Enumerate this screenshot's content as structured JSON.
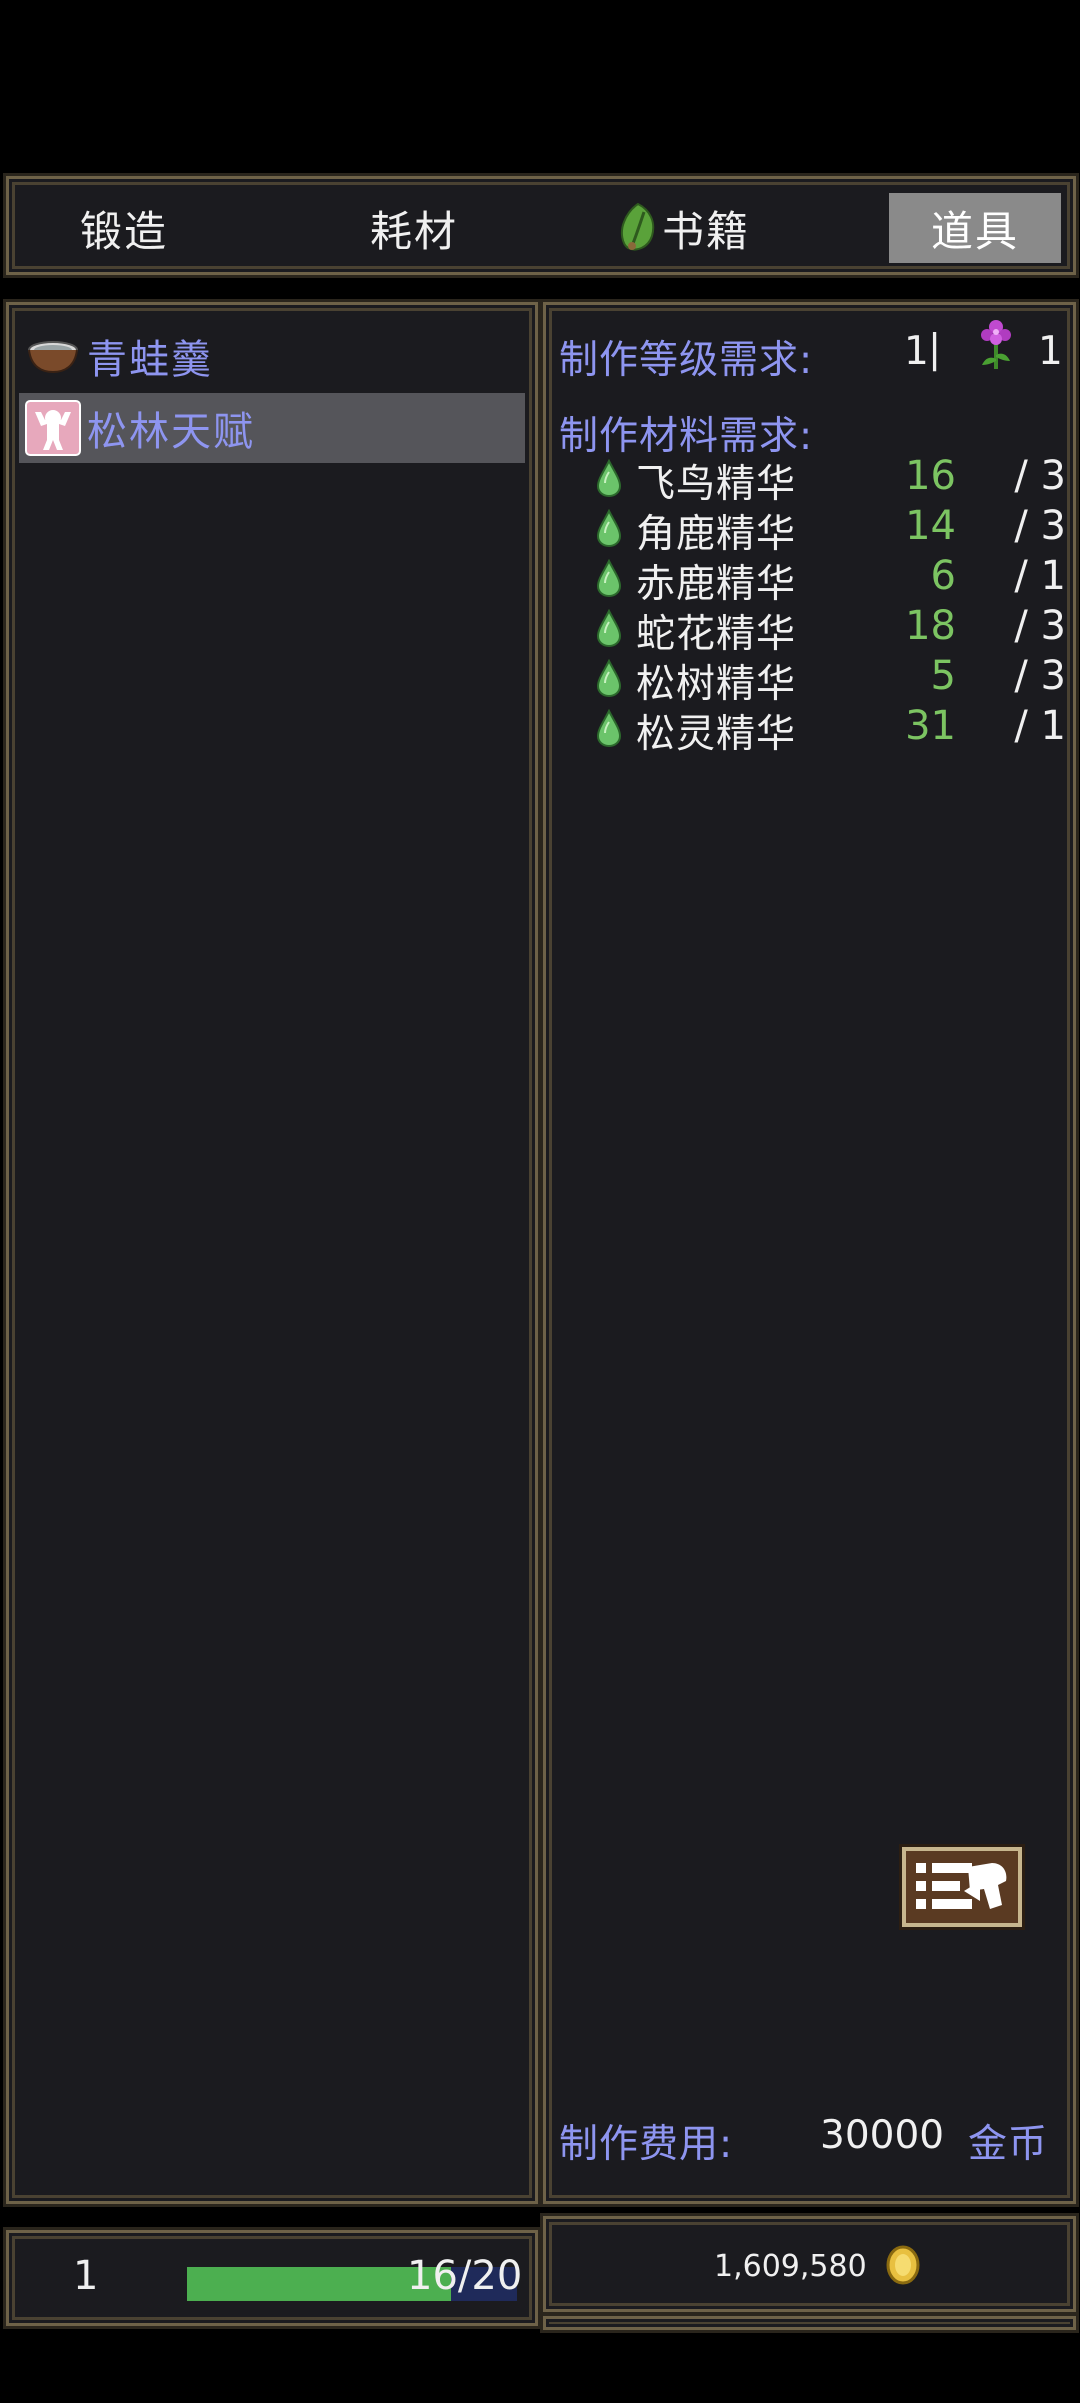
{
  "tabs": [
    {
      "label": "锻造",
      "active": false
    },
    {
      "label": "耗材",
      "active": false
    },
    {
      "label": "书籍",
      "active": false,
      "icon": "green-leaf-icon"
    },
    {
      "label": "道具",
      "active": true
    }
  ],
  "recipes": [
    {
      "label": "青蛙羹",
      "icon": "soup-bowl-icon",
      "selected": false
    },
    {
      "label": "松林天赋",
      "icon": "talent-figure-icon",
      "selected": true
    }
  ],
  "detail": {
    "level_label": "制作等级需求:",
    "level_value": "1",
    "level_separator": "|",
    "skill_value": "1",
    "materials_label": "制作材料需求:",
    "materials": [
      {
        "name": "飞鸟精华",
        "have": "16",
        "need": "/ 3"
      },
      {
        "name": "角鹿精华",
        "have": "14",
        "need": "/ 3"
      },
      {
        "name": "赤鹿精华",
        "have": "6",
        "need": "/ 1"
      },
      {
        "name": "蛇花精华",
        "have": "18",
        "need": "/ 3"
      },
      {
        "name": "松树精华",
        "have": "5",
        "need": "/ 3"
      },
      {
        "name": "松灵精华",
        "have": "31",
        "need": "/ 1"
      }
    ],
    "cost_label": "制作费用:",
    "cost_value": "30000",
    "cost_unit": "金币"
  },
  "footer": {
    "level": "1",
    "progress_text": "16/20",
    "progress_fraction": 0.8,
    "gold": "1,609,580"
  },
  "colors": {
    "accent_label": "#8e95f0",
    "have_green": "#7cc462",
    "frame": "#6e6248",
    "progress": "#4caf50"
  }
}
